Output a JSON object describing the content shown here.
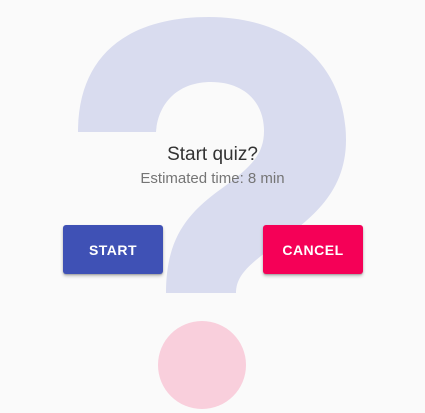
{
  "dialog": {
    "title": "Start quiz?",
    "subtitle": "Estimated time: 8 min"
  },
  "actions": {
    "start_label": "START",
    "cancel_label": "CANCEL"
  },
  "illustration": {
    "icon": "question-mark-icon",
    "question_color": "#d9dcef",
    "dot_color": "#f9cfdc"
  },
  "colors": {
    "primary": "#3f51b5",
    "accent": "#f50057",
    "background": "#fafafa"
  }
}
